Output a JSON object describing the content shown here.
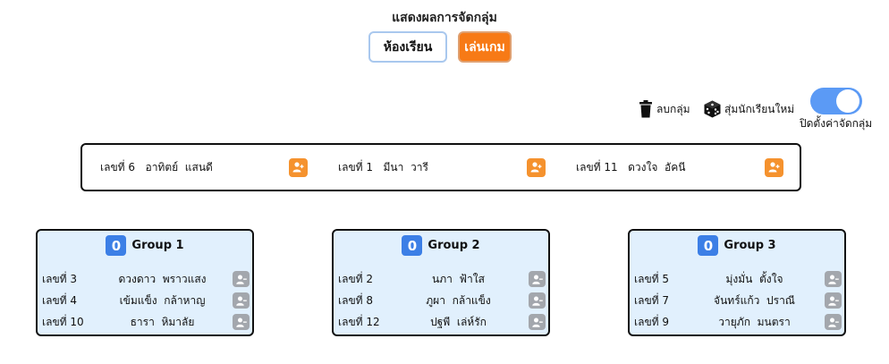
{
  "header": {
    "title": "แสดงผลการจัดกลุ่ม"
  },
  "modes": {
    "classroom_label": "ห้องเรียน",
    "game_label": "เล่นเกม",
    "active": "เล่นเกม"
  },
  "toolbar": {
    "delete_label": "ลบกลุ่ม",
    "delete_icon": "trash-icon",
    "shuffle_label": "สุ่มนักเรียนใหม่",
    "shuffle_icon": "dice-icon",
    "toggle_label": "ปิดตั้งค่าจัดกลุ่ม",
    "toggle_on": true
  },
  "pool": [
    {
      "number": "เลขที่ 6",
      "name": "อาทิตย์  แสนดี"
    },
    {
      "number": "เลขที่ 1",
      "name": "มีนา  วารี"
    },
    {
      "number": "เลขที่ 11",
      "name": "ดวงใจ  อัคนี"
    }
  ],
  "groups": [
    {
      "title": "Group 1",
      "count": "0",
      "members": [
        {
          "number": "เลขที่ 3",
          "name": "ดวงดาว  พราวแสง"
        },
        {
          "number": "เลขที่ 4",
          "name": "เข้มแข็ง  กล้าหาญ"
        },
        {
          "number": "เลขที่ 10",
          "name": "ธารา  หิมาลัย"
        }
      ]
    },
    {
      "title": "Group 2",
      "count": "0",
      "members": [
        {
          "number": "เลขที่ 2",
          "name": "นภา  ฟ้าใส"
        },
        {
          "number": "เลขที่ 8",
          "name": "ภูผา  กล้าแข็ง"
        },
        {
          "number": "เลขที่ 12",
          "name": "ปฐพี  เล่ห์รัก"
        }
      ]
    },
    {
      "title": "Group 3",
      "count": "0",
      "members": [
        {
          "number": "เลขที่ 5",
          "name": "มุ่งมั่น  ตั้งใจ"
        },
        {
          "number": "เลขที่ 7",
          "name": "จันทร์แก้ว  ปราณี"
        },
        {
          "number": "เลขที่ 9",
          "name": "วายุภัก  มนตรา"
        }
      ]
    }
  ],
  "colors": {
    "accent_blue": "#3c7fe6",
    "accent_orange": "#f77a16",
    "group_bg": "#e1f0fd"
  }
}
